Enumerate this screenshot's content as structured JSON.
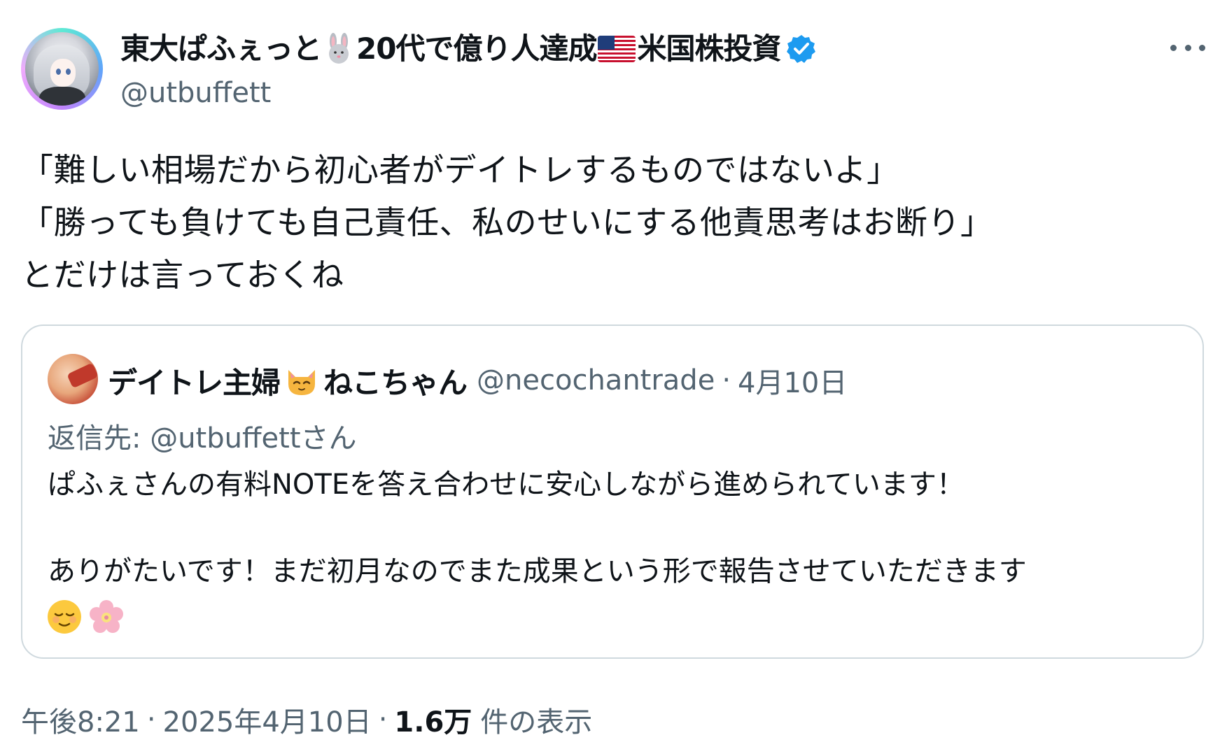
{
  "author": {
    "name_part1": "東大ぱふぇっと",
    "name_part2": "20代で億り人達成",
    "name_part3": "米国株投資",
    "handle": "@utbuffett"
  },
  "tweet": {
    "lines": [
      "「難しい相場だから初心者がデイトレするものではないよ」",
      "「勝っても負けても自己責任、私のせいにする他責思考はお断り」",
      "とだけは言っておくね"
    ]
  },
  "quote": {
    "name_part1": "デイトレ主婦",
    "name_part2": "ねこちゃん",
    "handle": "@necochantrade",
    "separator": "·",
    "date": "4月10日",
    "reply_prefix": "返信先:",
    "reply_mention": "@utbuffettさん",
    "lines": [
      "ぱふぇさんの有料NOTEを答え合わせに安心しながら進められています！",
      "",
      "ありがたいです！まだ初月なのでまた成果という形で報告させていただきます"
    ]
  },
  "footer": {
    "time": "午後8:21",
    "sep1": "·",
    "date": "2025年4月10日",
    "sep2": "·",
    "views_count": "1.6万",
    "views_label": "件の表示"
  },
  "icons": {
    "verified_color": "#1d9bf0"
  }
}
